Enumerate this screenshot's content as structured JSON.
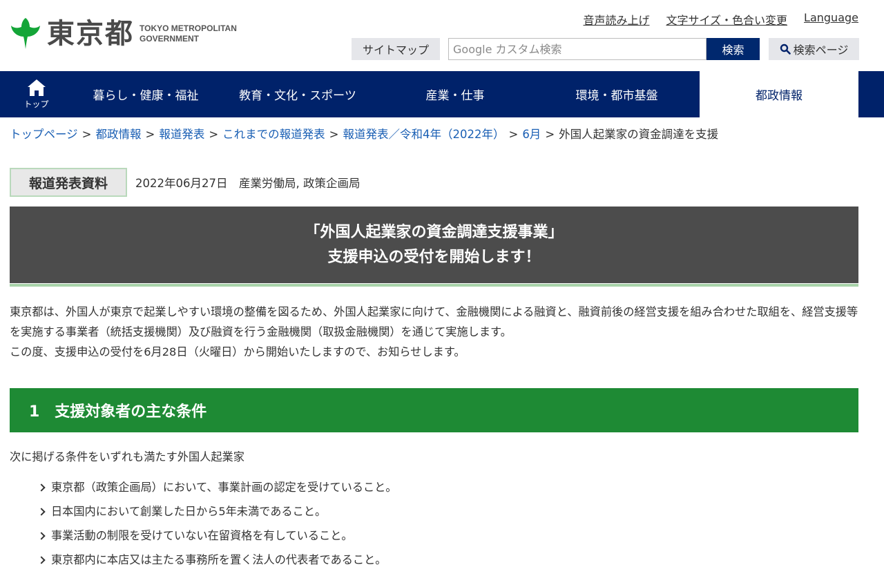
{
  "header": {
    "logo_jp": "東京都",
    "logo_en_line1": "TOKYO METROPOLITAN",
    "logo_en_line2": "GOVERNMENT",
    "util_links": [
      "音声読み上げ",
      "文字サイズ・色合い変更",
      "Language"
    ],
    "sitemap_label": "サイトマップ",
    "search_placeholder": "Google カスタム検索",
    "search_button": "検索",
    "search_page_button": "検索ページ"
  },
  "nav": {
    "home_label": "トップ",
    "items": [
      "暮らし・健康・福祉",
      "教育・文化・スポーツ",
      "産業・仕事",
      "環境・都市基盤",
      "都政情報"
    ],
    "active_index": 4
  },
  "breadcrumb": {
    "links": [
      "トップページ",
      "都政情報",
      "報道発表",
      "これまでの報道発表",
      "報道発表／令和4年（2022年）",
      "6月"
    ],
    "separator": ">",
    "current": "外国人起業家の資金調達を支援"
  },
  "press": {
    "label": "報道発表資料",
    "date_dept": "2022年06月27日　産業労働局, 政策企画局"
  },
  "title": {
    "line1": "「外国人起業家の資金調達支援事業」",
    "line2": "支援申込の受付を開始します！"
  },
  "intro": {
    "para1": "東京都は、外国人が東京で起業しやすい環境の整備を図るため、外国人起業家に向けて、金融機関による融資と、融資前後の経営支援を組み合わせた取組を、経営支援等を実施する事業者（統括支援機関）及び融資を行う金融機関（取扱金融機関）を通じて実施します。",
    "para2": "この度、支援申込の受付を6月28日（火曜日）から開始いたしますので、お知らせします。"
  },
  "section1": {
    "heading": "1　支援対象者の主な条件",
    "lead": "次に掲げる条件をいずれも満たす外国人起業家",
    "conditions": [
      "東京都（政策企画局）において、事業計画の認定を受けていること。",
      "日本国内において創業した日から5年未満であること。",
      "事業活動の制限を受けていない在留資格を有していること。",
      "東京都内に本店又は主たる事務所を置く法人の代表者であること。"
    ]
  },
  "colors": {
    "nav_bg": "#00226a",
    "section_green": "#1e8a34",
    "title_bg": "#4c4c4c",
    "link_blue": "#1a5fb4",
    "logo_green": "#14a538"
  }
}
